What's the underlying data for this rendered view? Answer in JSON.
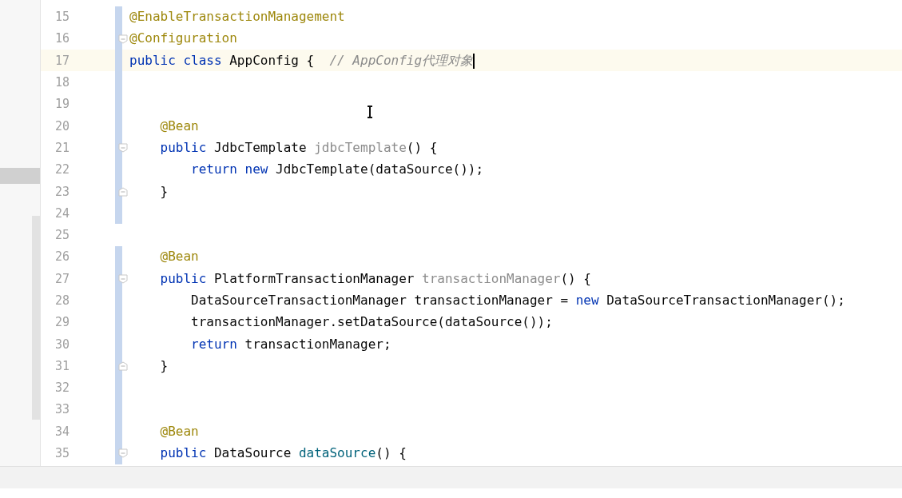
{
  "editor": {
    "lines": [
      {
        "number": "15",
        "current": false,
        "changed": true,
        "fold_start": false,
        "fold_end": false,
        "tokens": [
          {
            "kind": "annotation",
            "text": "@EnableTransactionManagement"
          }
        ]
      },
      {
        "number": "16",
        "current": false,
        "changed": true,
        "fold_start": true,
        "fold_end": false,
        "tokens": [
          {
            "kind": "annotation",
            "text": "@Configuration"
          }
        ]
      },
      {
        "number": "17",
        "current": true,
        "changed": true,
        "fold_start": false,
        "fold_end": false,
        "caret": true,
        "tokens": [
          {
            "kind": "keyword",
            "text": "public class "
          },
          {
            "kind": "plain",
            "text": "AppConfig {  "
          },
          {
            "kind": "comment",
            "text": "// AppConfig代理对象"
          }
        ]
      },
      {
        "number": "18",
        "current": false,
        "changed": true,
        "fold_start": false,
        "fold_end": false
      },
      {
        "number": "19",
        "current": false,
        "changed": true,
        "fold_start": false,
        "fold_end": false
      },
      {
        "number": "20",
        "current": false,
        "changed": true,
        "fold_start": false,
        "fold_end": false,
        "tokens": [
          {
            "kind": "annotation",
            "text": "    @Bean"
          }
        ]
      },
      {
        "number": "21",
        "current": false,
        "changed": true,
        "fold_start": true,
        "fold_end": false,
        "tokens": [
          {
            "kind": "keyword",
            "text": "    public "
          },
          {
            "kind": "plain",
            "text": "JdbcTemplate "
          },
          {
            "kind": "unused",
            "text": "jdbcTemplate"
          },
          {
            "kind": "plain",
            "text": "() {"
          }
        ]
      },
      {
        "number": "22",
        "current": false,
        "changed": true,
        "fold_start": false,
        "fold_end": false,
        "tokens": [
          {
            "kind": "keyword",
            "text": "        return new "
          },
          {
            "kind": "plain",
            "text": "JdbcTemplate(dataSource());"
          }
        ]
      },
      {
        "number": "23",
        "current": false,
        "changed": true,
        "fold_start": false,
        "fold_end": true,
        "tokens": [
          {
            "kind": "plain",
            "text": "    }"
          }
        ]
      },
      {
        "number": "24",
        "current": false,
        "changed": true,
        "fold_start": false,
        "fold_end": false
      },
      {
        "number": "25",
        "current": false,
        "changed": false,
        "fold_start": false,
        "fold_end": false
      },
      {
        "number": "26",
        "current": false,
        "changed": true,
        "fold_start": false,
        "fold_end": false,
        "tokens": [
          {
            "kind": "annotation",
            "text": "    @Bean"
          }
        ]
      },
      {
        "number": "27",
        "current": false,
        "changed": true,
        "fold_start": true,
        "fold_end": false,
        "tokens": [
          {
            "kind": "keyword",
            "text": "    public "
          },
          {
            "kind": "plain",
            "text": "PlatformTransactionManager "
          },
          {
            "kind": "unused",
            "text": "transactionManager"
          },
          {
            "kind": "plain",
            "text": "() {"
          }
        ]
      },
      {
        "number": "28",
        "current": false,
        "changed": true,
        "fold_start": false,
        "fold_end": false,
        "tokens": [
          {
            "kind": "plain",
            "text": "        DataSourceTransactionManager transactionManager = "
          },
          {
            "kind": "keyword",
            "text": "new "
          },
          {
            "kind": "plain",
            "text": "DataSourceTransactionManager();"
          }
        ]
      },
      {
        "number": "29",
        "current": false,
        "changed": true,
        "fold_start": false,
        "fold_end": false,
        "tokens": [
          {
            "kind": "plain",
            "text": "        transactionManager.setDataSource(dataSource());"
          }
        ]
      },
      {
        "number": "30",
        "current": false,
        "changed": true,
        "fold_start": false,
        "fold_end": false,
        "tokens": [
          {
            "kind": "keyword",
            "text": "        return "
          },
          {
            "kind": "plain",
            "text": "transactionManager;"
          }
        ]
      },
      {
        "number": "31",
        "current": false,
        "changed": true,
        "fold_start": false,
        "fold_end": true,
        "tokens": [
          {
            "kind": "plain",
            "text": "    }"
          }
        ]
      },
      {
        "number": "32",
        "current": false,
        "changed": true,
        "fold_start": false,
        "fold_end": false
      },
      {
        "number": "33",
        "current": false,
        "changed": true,
        "fold_start": false,
        "fold_end": false
      },
      {
        "number": "34",
        "current": false,
        "changed": true,
        "fold_start": false,
        "fold_end": false,
        "tokens": [
          {
            "kind": "annotation",
            "text": "    @Bean"
          }
        ]
      },
      {
        "number": "35",
        "current": false,
        "changed": true,
        "fold_start": true,
        "fold_end": false,
        "tokens": [
          {
            "kind": "keyword",
            "text": "    public "
          },
          {
            "kind": "plain",
            "text": "DataSource "
          },
          {
            "kind": "method",
            "text": "dataSource"
          },
          {
            "kind": "plain",
            "text": "() {"
          }
        ]
      }
    ]
  }
}
